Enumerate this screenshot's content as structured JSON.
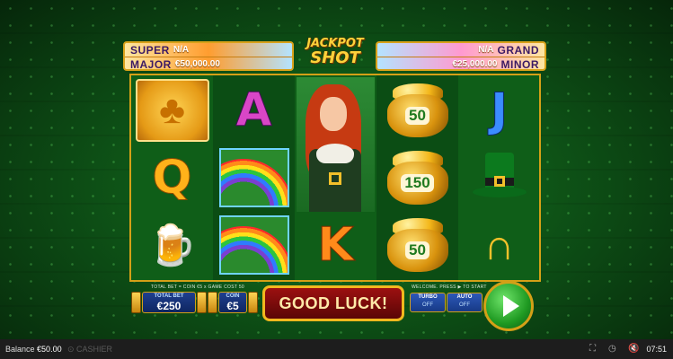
{
  "jackpot": {
    "title_line1": "JACKPOT",
    "title_line2": "SHOT",
    "super_label": "SUPER",
    "super_value": "N/A",
    "major_label": "MAJOR",
    "major_value": "€50,000.00",
    "grand_label": "GRAND",
    "grand_value": "N/A",
    "minor_label": "MINOR",
    "minor_value": "€25,000.00"
  },
  "reels": [
    [
      "clover",
      "A",
      "J"
    ],
    [
      "Q",
      "rainbow",
      "hat"
    ],
    [
      "beer",
      "rainbow",
      "horseshoe"
    ]
  ],
  "pot_values": [
    "50",
    "150",
    "50"
  ],
  "letters": {
    "a": "A",
    "j": "J",
    "q": "Q",
    "k": "K"
  },
  "controls": {
    "info_left": "TOTAL BET = COIN €5 x GAME COST 50",
    "info_right": "WELCOME. PRESS ▶ TO START",
    "total_bet_label": "TOTAL BET",
    "total_bet_value": "€250",
    "coin_label": "COIN",
    "coin_value": "€5",
    "message": "GOOD LUCK!",
    "turbo_label": "TURBO",
    "turbo_value": "OFF",
    "auto_label": "AUTO",
    "auto_value": "OFF"
  },
  "status_bar": {
    "balance_label": "Balance",
    "balance_value": "€50.00",
    "cashier_label": "CASHIER",
    "time": "07:51"
  }
}
